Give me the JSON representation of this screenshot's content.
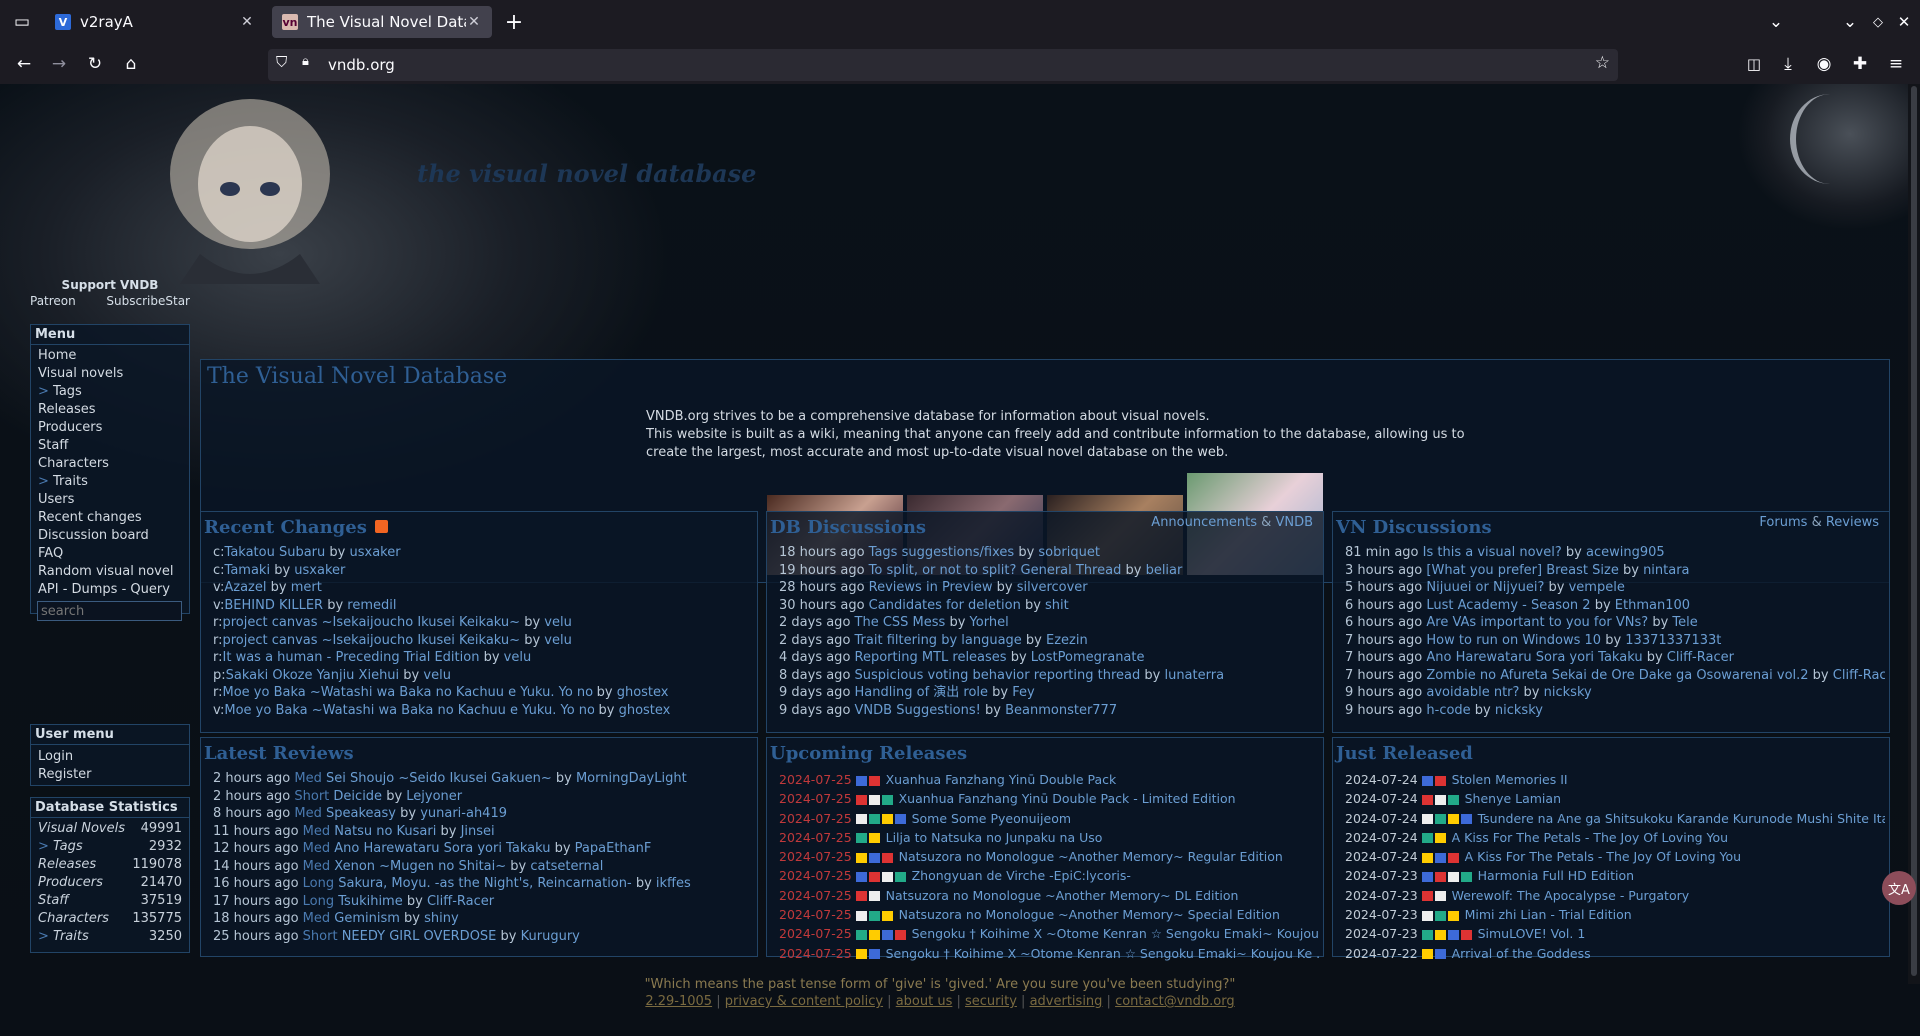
{
  "browser": {
    "tabs": [
      {
        "title": "v2rayA",
        "favicon": "V"
      },
      {
        "title": "The Visual Novel Database",
        "favicon": "vn"
      }
    ],
    "url": "vndb.org"
  },
  "site": {
    "logo_title": "the visual novel database",
    "support": {
      "title": "Support VNDB",
      "patreon": "Patreon",
      "subscribestar": "SubscribeStar"
    },
    "menu": {
      "title": "Menu",
      "items": [
        "Home",
        "Visual novels",
        "> Tags",
        "Releases",
        "Producers",
        "Staff",
        "Characters",
        "> Traits",
        "Users",
        "Recent changes",
        "Discussion board",
        "FAQ",
        "Random visual novel",
        "API - Dumps - Query"
      ],
      "search_placeholder": "search"
    },
    "user_menu": {
      "title": "User menu",
      "items": [
        "Login",
        "Register"
      ]
    },
    "stats": {
      "title": "Database Statistics",
      "rows": [
        [
          "Visual Novels",
          "49991"
        ],
        [
          "> Tags",
          "2932"
        ],
        [
          "Releases",
          "119078"
        ],
        [
          "Producers",
          "21470"
        ],
        [
          "Staff",
          "37519"
        ],
        [
          "Characters",
          "135775"
        ],
        [
          "> Traits",
          "3250"
        ]
      ]
    },
    "main": {
      "title": "The Visual Novel Database",
      "intro1": "VNDB.org strives to be a comprehensive database for information about visual novels.",
      "intro2": "This website is built as a wiki, meaning that anyone can freely add and contribute information to the database, allowing us to",
      "intro3": "create the largest, most accurate and most up-to-date visual novel database on the web."
    },
    "recent_changes": {
      "title": "Recent Changes",
      "rows": [
        [
          "c:",
          "Takatou Subaru",
          "usxaker"
        ],
        [
          "c:",
          "Tamaki",
          "usxaker"
        ],
        [
          "v:",
          "Azazel",
          "mert"
        ],
        [
          "v:",
          "BEHIND KILLER",
          "remedil"
        ],
        [
          "r:",
          "project canvas ~Isekaijoucho Ikusei Keikaku~",
          "velu"
        ],
        [
          "r:",
          "project canvas ~Isekaijoucho Ikusei Keikaku~",
          "velu"
        ],
        [
          "r:",
          "It was a human - Preceding Trial Edition",
          "velu"
        ],
        [
          "p:",
          "Sakaki Okoze Yanjiu Xiehui",
          "velu"
        ],
        [
          "r:",
          "Moe yo Baka ~Watashi wa Baka no Kachuu e Yuku. Yo no Baka ni Akita M...",
          "ghostex"
        ],
        [
          "v:",
          "Moe yo Baka ~Watashi wa Baka no Kachuu e Yuku. Yo no Baka ni Akita M...",
          "ghostex"
        ]
      ]
    },
    "db_discussions": {
      "title": "DB Discussions",
      "links": [
        "Announcements",
        "&",
        "VNDB"
      ],
      "rows": [
        [
          "18 hours ago",
          "Tags suggestions/fixes",
          "sobriquet"
        ],
        [
          "19 hours ago",
          "To split, or not to split? General Thread",
          "beliar"
        ],
        [
          "28 hours ago",
          "Reviews in Preview",
          "silvercover"
        ],
        [
          "30 hours ago",
          "Candidates for deletion",
          "shit"
        ],
        [
          "2 days ago",
          "The CSS Mess",
          "Yorhel"
        ],
        [
          "2 days ago",
          "Trait filtering by language",
          "Ezezin"
        ],
        [
          "4 days ago",
          "Reporting MTL releases",
          "LostPomegranate"
        ],
        [
          "8 days ago",
          "Suspicious voting behavior reporting thread",
          "lunaterra"
        ],
        [
          "9 days ago",
          "Handling of 演出 role",
          "Fey"
        ],
        [
          "9 days ago",
          "VNDB Suggestions!",
          "Beanmonster777"
        ]
      ]
    },
    "vn_discussions": {
      "title": "VN Discussions",
      "links": [
        "Forums",
        "&",
        "Reviews"
      ],
      "rows": [
        [
          "81 min ago",
          "Is this a visual novel?",
          "acewing905"
        ],
        [
          "3 hours ago",
          "[What you prefer] Breast Size",
          "nintara"
        ],
        [
          "5 hours ago",
          "Nijuuei or Nijyuei?",
          "vempele"
        ],
        [
          "6 hours ago",
          "Lust Academy - Season 2",
          "Ethman100"
        ],
        [
          "6 hours ago",
          "Are VAs important to you for VNs?",
          "Tele"
        ],
        [
          "7 hours ago",
          "How to run on Windows 10",
          "13371337133t"
        ],
        [
          "7 hours ago",
          "Ano Harewataru Sora yori Takaku",
          "Cliff-Racer"
        ],
        [
          "7 hours ago",
          "Zombie no Afureta Sekai de Ore Dake ga Osowarenai vol.2",
          "Cliff-Racer"
        ],
        [
          "9 hours ago",
          "avoidable ntr?",
          "nicksky"
        ],
        [
          "9 hours ago",
          "h-code",
          "nicksky"
        ]
      ]
    },
    "latest_reviews": {
      "title": "Latest Reviews",
      "rows": [
        [
          "2 hours ago",
          "Med",
          "Sei Shoujo ~Seido Ikusei Gakuen~",
          "MorningDayLight"
        ],
        [
          "2 hours ago",
          "Short",
          "Deicide",
          "Lejyoner"
        ],
        [
          "8 hours ago",
          "Med",
          "Speakeasy",
          "yunari-ah419"
        ],
        [
          "11 hours ago",
          "Med",
          "Natsu no Kusari",
          "Jinsei"
        ],
        [
          "12 hours ago",
          "Med",
          "Ano Harewataru Sora yori Takaku",
          "PapaEthanF"
        ],
        [
          "14 hours ago",
          "Med",
          "Xenon ~Mugen no Shitai~",
          "catseternal"
        ],
        [
          "16 hours ago",
          "Long",
          "Sakura, Moyu. -as the Night's, Reincarnation-",
          "ikffes"
        ],
        [
          "17 hours ago",
          "Long",
          "Tsukihime",
          "Cliff-Racer"
        ],
        [
          "18 hours ago",
          "Med",
          "Geminism",
          "shiny"
        ],
        [
          "25 hours ago",
          "Short",
          "NEEDY GIRL OVERDOSE",
          "Kurugury"
        ]
      ]
    },
    "upcoming_releases": {
      "title": "Upcoming Releases",
      "rows": [
        [
          "2024-07-25",
          "Xuanhua Fanzhang Yinū Double Pack"
        ],
        [
          "2024-07-25",
          "Xuanhua Fanzhang Yinū Double Pack - Limited Edition"
        ],
        [
          "2024-07-25",
          "Some Some Pyeonuijeom"
        ],
        [
          "2024-07-25",
          "Lilja to Natsuka no Junpaku na Uso"
        ],
        [
          "2024-07-25",
          "Natsuzora no Monologue ~Another Memory~ Regular Edition"
        ],
        [
          "2024-07-25",
          "Zhongyuan de Virche -EpiC:lycoris-"
        ],
        [
          "2024-07-25",
          "Natsuzora no Monologue ~Another Memory~ DL Edition"
        ],
        [
          "2024-07-25",
          "Natsuzora no Monologue ~Another Memory~ Special Edition"
        ],
        [
          "2024-07-25",
          "Sengoku † Koihime X ~Otome Kenran ☆ Sengoku Emaki~ Koujou Ke ..."
        ],
        [
          "2024-07-25",
          "Sengoku † Koihime X ~Otome Kenran ☆ Sengoku Emaki~ Koujou Ke ..."
        ]
      ]
    },
    "just_released": {
      "title": "Just Released",
      "rows": [
        [
          "2024-07-24",
          "Stolen Memories II"
        ],
        [
          "2024-07-24",
          "Shenye Lamian"
        ],
        [
          "2024-07-24",
          "Tsundere na Ane ga Shitsukoku Karande Kurunode Mushi Shite Itara..."
        ],
        [
          "2024-07-24",
          "A Kiss For The Petals - The Joy Of Loving You"
        ],
        [
          "2024-07-24",
          "A Kiss For The Petals - The Joy Of Loving You"
        ],
        [
          "2024-07-23",
          "Harmonia Full HD Edition"
        ],
        [
          "2024-07-23",
          "Werewolf: The Apocalypse - Purgatory"
        ],
        [
          "2024-07-23",
          "Mimi zhi Lian - Trial Edition"
        ],
        [
          "2024-07-23",
          "SimuLOVE! Vol. 1"
        ],
        [
          "2024-07-22",
          "Arrival of the Goddess"
        ]
      ]
    },
    "footer": {
      "quote": "\"Which means the past tense form of 'give' is 'gived.' Are you sure you've been studying?\"",
      "links": [
        "2.29-1005",
        "privacy & content policy",
        "about us",
        "security",
        "advertising",
        "contact@vndb.org"
      ]
    },
    "by": "by"
  },
  "colors": {
    "accent": "#2f5f94",
    "link": "#6b9ed3",
    "date_upcoming": "#c0393b"
  }
}
